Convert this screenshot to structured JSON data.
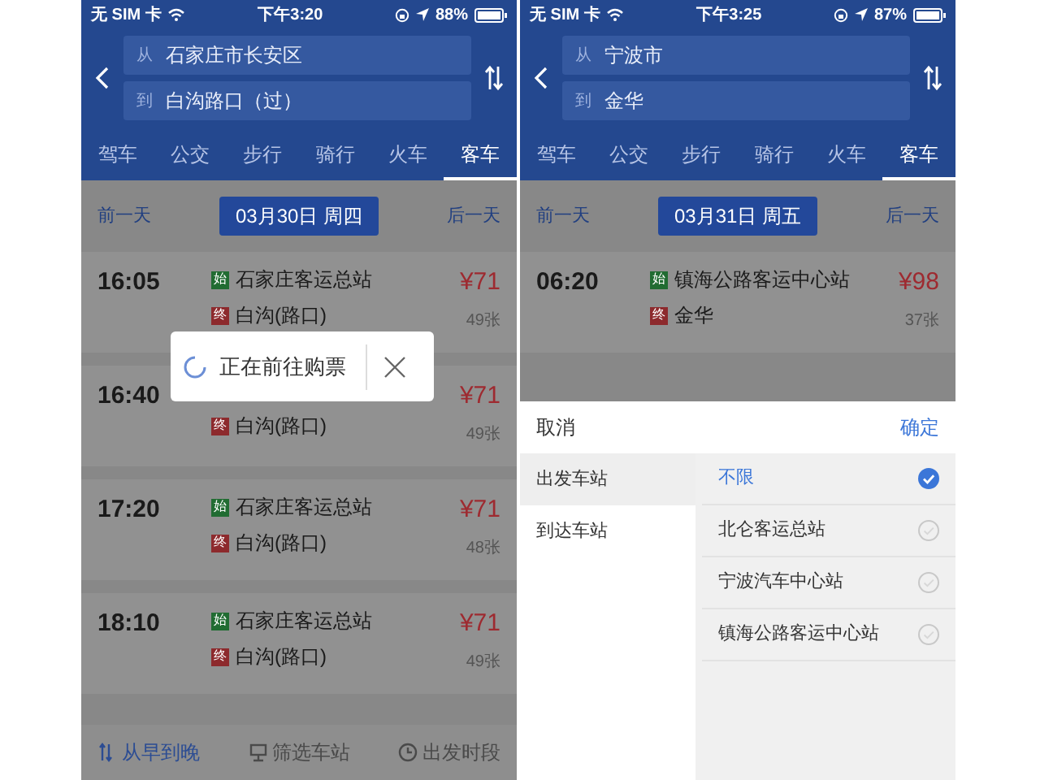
{
  "screens": [
    {
      "dimmed": true,
      "status_bar": {
        "carrier": "无 SIM 卡",
        "time": "下午3:20",
        "battery": "88%"
      },
      "route": {
        "from_prefix": "从",
        "from": "石家庄市长安区",
        "to_prefix": "到",
        "to": "白沟路口（过）"
      },
      "tabs": [
        {
          "label": "驾车",
          "selected": false
        },
        {
          "label": "公交",
          "selected": false
        },
        {
          "label": "步行",
          "selected": false
        },
        {
          "label": "骑行",
          "selected": false
        },
        {
          "label": "火车",
          "selected": false
        },
        {
          "label": "客车",
          "selected": true
        }
      ],
      "date_nav": {
        "prev": "前一天",
        "date": "03月30日 周四",
        "next": "后一天"
      },
      "trips": [
        {
          "time": "16:05",
          "origin_tag": "始",
          "origin": "石家庄客运总站",
          "dest_tag": "终",
          "dest": "白沟(路口)",
          "price": "¥71",
          "seats": "49张"
        },
        {
          "time": "16:40",
          "dest_tag": "终",
          "dest": "白沟(路口)",
          "price": "¥71",
          "seats": "49张"
        },
        {
          "time": "17:20",
          "origin_tag": "始",
          "origin": "石家庄客运总站",
          "dest_tag": "终",
          "dest": "白沟(路口)",
          "price": "¥71",
          "seats": "48张"
        },
        {
          "time": "18:10",
          "origin_tag": "始",
          "origin": "石家庄客运总站",
          "dest_tag": "终",
          "dest": "白沟(路口)",
          "price": "¥71",
          "seats": "49张"
        }
      ],
      "sort_bar": [
        {
          "kind": "sort",
          "label": "从早到晚",
          "selected": true
        },
        {
          "kind": "filter",
          "label": "筛选车站",
          "selected": false
        },
        {
          "kind": "clock",
          "label": "出发时段",
          "selected": false
        }
      ],
      "dialog": {
        "message": "正在前往购票"
      }
    },
    {
      "dimmed": true,
      "status_bar": {
        "carrier": "无 SIM 卡",
        "time": "下午3:25",
        "battery": "87%"
      },
      "route": {
        "from_prefix": "从",
        "from": "宁波市",
        "to_prefix": "到",
        "to": "金华"
      },
      "tabs": [
        {
          "label": "驾车",
          "selected": false
        },
        {
          "label": "公交",
          "selected": false
        },
        {
          "label": "步行",
          "selected": false
        },
        {
          "label": "骑行",
          "selected": false
        },
        {
          "label": "火车",
          "selected": false
        },
        {
          "label": "客车",
          "selected": true
        }
      ],
      "date_nav": {
        "prev": "前一天",
        "date": "03月31日 周五",
        "next": "后一天"
      },
      "trips": [
        {
          "time": "06:20",
          "origin_tag": "始",
          "origin": "镇海公路客运中心站",
          "dest_tag": "终",
          "dest": "金华",
          "price": "¥98",
          "seats": "37张"
        }
      ],
      "station_filter": {
        "cancel": "取消",
        "confirm": "确定",
        "categories": [
          {
            "label": "出发车站",
            "selected": true
          },
          {
            "label": "到达车站",
            "selected": false
          }
        ],
        "options": [
          {
            "label": "不限",
            "selected": true
          },
          {
            "label": "北仑客运总站",
            "selected": false
          },
          {
            "label": "宁波汽车中心站",
            "selected": false
          },
          {
            "label": "镇海公路客运中心站",
            "selected": false
          }
        ]
      }
    }
  ]
}
